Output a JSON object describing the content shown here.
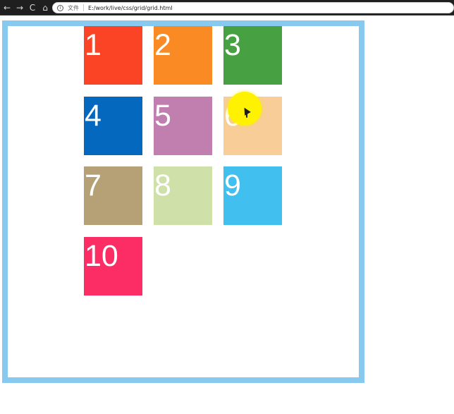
{
  "browser": {
    "nav": {
      "back": "←",
      "forward": "→",
      "reload": "C",
      "home": "⌂"
    },
    "address": {
      "info_icon": "i",
      "file_label": "文件",
      "url": "E:/work/live/css/grid/grid.html"
    }
  },
  "grid": {
    "items": [
      {
        "label": "1",
        "color": "#fb4425"
      },
      {
        "label": "2",
        "color": "#fa8b24"
      },
      {
        "label": "3",
        "color": "#47a041"
      },
      {
        "label": "4",
        "color": "#0468bf"
      },
      {
        "label": "5",
        "color": "#c17fb0"
      },
      {
        "label": "6",
        "color": "#f8cd98"
      },
      {
        "label": "7",
        "color": "#b6a176"
      },
      {
        "label": "8",
        "color": "#cfe0a8"
      },
      {
        "label": "9",
        "color": "#41bfee"
      },
      {
        "label": "10",
        "color": "#fb2d64"
      }
    ]
  },
  "cursor": {
    "icon": "pointer-cursor-icon",
    "highlight": "#fff200"
  },
  "colors": {
    "container_border": "#88c9ef"
  }
}
